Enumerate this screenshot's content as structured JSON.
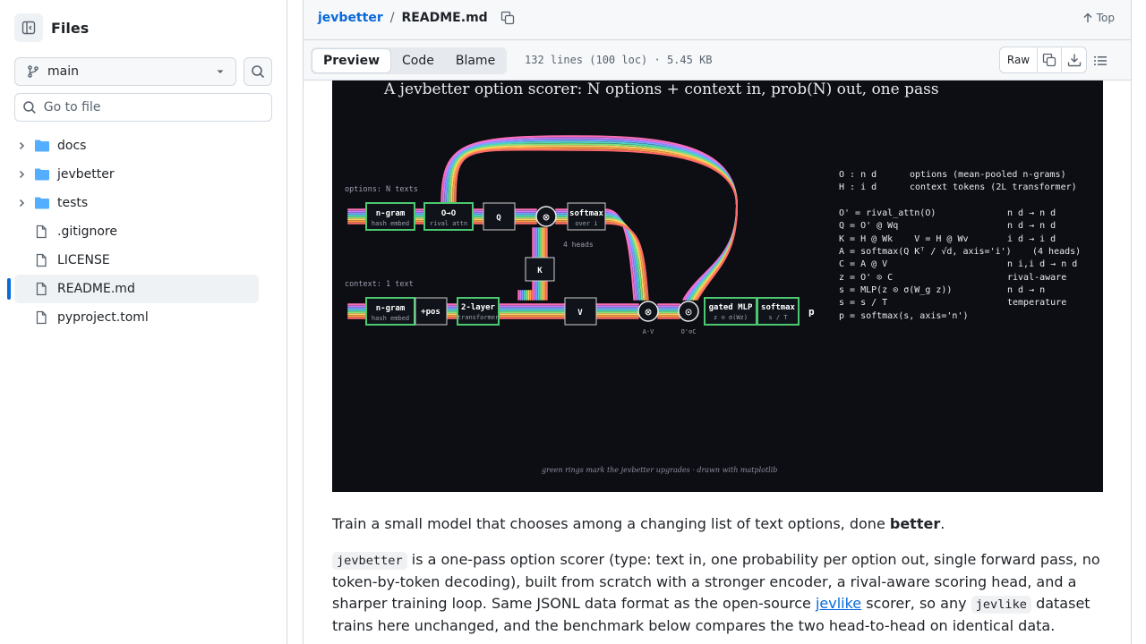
{
  "sidebar": {
    "title": "Files",
    "branch": "main",
    "go_to_file_placeholder": "Go to file",
    "items": [
      {
        "type": "dir",
        "name": "docs"
      },
      {
        "type": "dir",
        "name": "jevbetter"
      },
      {
        "type": "dir",
        "name": "tests"
      },
      {
        "type": "file",
        "name": ".gitignore"
      },
      {
        "type": "file",
        "name": "LICENSE"
      },
      {
        "type": "file",
        "name": "README.md",
        "active": true
      },
      {
        "type": "file",
        "name": "pyproject.toml"
      }
    ]
  },
  "header": {
    "repo": "jevbetter",
    "separator": "/",
    "file": "README.md",
    "top_label": "Top"
  },
  "toolbar": {
    "tabs": [
      "Preview",
      "Code",
      "Blame"
    ],
    "active_tab": "Preview",
    "file_info": "132 lines (100 loc) · 5.45 KB",
    "raw_label": "Raw"
  },
  "figure": {
    "title": "A jevbetter option scorer: N options + context in, prob(N) out, one pass",
    "options_label": "options: N texts",
    "context_label": "context: 1 text",
    "heads_label": "4 heads",
    "footer": "green rings mark the jevbetter upgrades  ·  drawn with matplotlib",
    "top_row": [
      {
        "title": "n-gram",
        "sub": "hash embed"
      },
      {
        "title": "O→O",
        "sub": "rival attn"
      },
      {
        "title": "Q",
        "sub": ""
      },
      {
        "title": "softmax",
        "sub": "over i"
      }
    ],
    "k_box": "K",
    "bottom_row": [
      {
        "title": "n-gram",
        "sub": "hash embed"
      },
      {
        "title": "+pos",
        "sub": ""
      },
      {
        "title": "2-layer",
        "sub": "transformer"
      },
      {
        "title": "V",
        "sub": ""
      },
      {
        "title": "gated MLP",
        "sub": "z ⊙ σ(Wz)"
      },
      {
        "title": "softmax",
        "sub": "s / T"
      }
    ],
    "op_otimes_top": "⊗",
    "op_otimes_bottom": "⊗",
    "op_odot": "⊙",
    "av_label": "A·V",
    "oc_label": "O'⊙C",
    "output_label": "p",
    "legend": [
      {
        "left": "O : n d",
        "right": "options (mean-pooled n-grams)"
      },
      {
        "left": "H : i d",
        "right": "context tokens (2L transformer)"
      }
    ],
    "equations": [
      {
        "left": "O' = rival_attn(O)",
        "right": "n d → n d"
      },
      {
        "left": "Q = O' @ Wq",
        "right": "n d → n d"
      },
      {
        "left": "K = H @ Wk    V = H @ Wv",
        "right": "i d → i d"
      },
      {
        "left": "A = softmax(Q Kᵀ / √d, axis='i')",
        "right": "(4 heads)"
      },
      {
        "left": "C = A @ V",
        "right": "n i,i d → n d"
      },
      {
        "left": "z = O' ⊙ C",
        "right": "rival-aware"
      },
      {
        "left": "s = MLP(z ⊙ σ(W_g z))",
        "right": "n d → n"
      },
      {
        "left": "s = s / T",
        "right": "temperature"
      },
      {
        "left": "p = softmax(s, axis='n')",
        "right": ""
      }
    ]
  },
  "readme": {
    "p1_text": "Train a small model that chooses among a changing list of text options, done ",
    "p1_bold": "better",
    "p1_end": ".",
    "p2_code1": "jevbetter",
    "p2_a": " is a one-pass option scorer (type: text in, one probability per option out, single forward pass, no token-by-token decoding), built from scratch with a stronger encoder, a rival-aware scoring head, and a sharper training loop. Same JSONL data format as the open-source ",
    "p2_link": "jevlike",
    "p2_b": " scorer, so any ",
    "p2_code2": "jevlike",
    "p2_c": " dataset trains here unchanged, and the benchmark below compares the two head-to-head on identical data."
  }
}
